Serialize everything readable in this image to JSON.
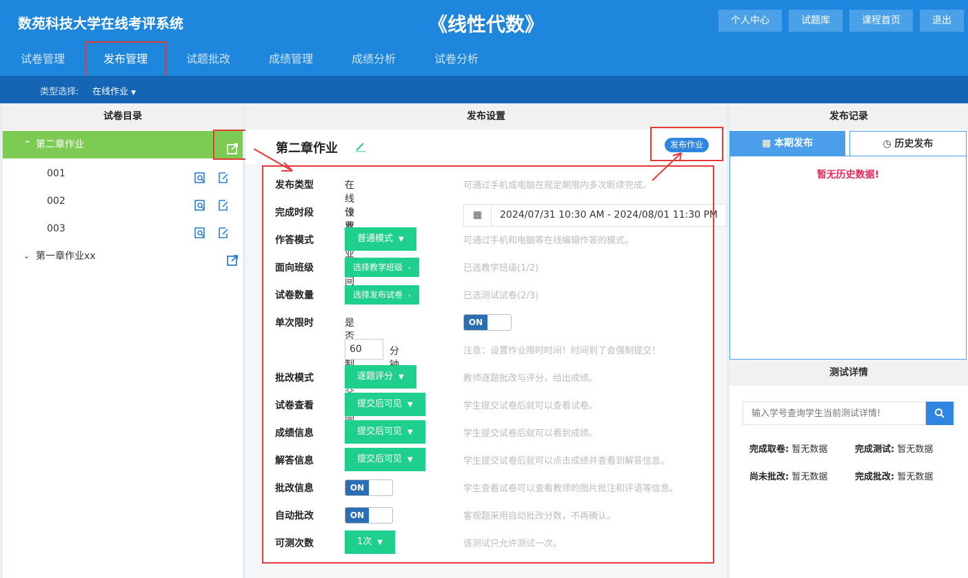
{
  "header": {
    "system_title": "数苑科技大学在线考评系统",
    "course_title": "《线性代数》",
    "buttons": [
      "个人中心",
      "试题库",
      "课程首页",
      "退出"
    ]
  },
  "nav": {
    "items": [
      "试卷管理",
      "发布管理",
      "试题批改",
      "成绩管理",
      "成绩分析",
      "试卷分析"
    ],
    "active_index": 1
  },
  "type_selector": {
    "label": "类型选择:",
    "value": "在线作业"
  },
  "left_panel": {
    "title": "试卷目录",
    "tree": [
      {
        "label": "第二章作业",
        "expanded": true,
        "children": [
          "001",
          "002",
          "003"
        ]
      },
      {
        "label": "第一章作业xx",
        "expanded": false
      }
    ]
  },
  "center_panel": {
    "title": "发布设置",
    "paper_title": "第二章作业",
    "publish_button": "发布作业",
    "rows": {
      "type": {
        "label": "发布类型",
        "value": "在线作业",
        "hint": "可通过手机或电脑在规定期限内多次断续完成。"
      },
      "period": {
        "label": "完成时段",
        "value": "设置作业时间段",
        "date_range": "2024/07/31 10:30 AM - 2024/08/01 11:30 PM"
      },
      "mode": {
        "label": "作答模式",
        "button": "普通模式",
        "hint": "可通过手机和电脑等在线编辑作答的模式。"
      },
      "classes": {
        "label": "面向班级",
        "button": "选择教学班级",
        "hint": "已选教学班级(1/2)"
      },
      "papers": {
        "label": "试卷数量",
        "button": "选择发布试卷",
        "hint": "已选测试试卷(2/3)"
      },
      "time_limit": {
        "label": "单次限时",
        "value": "是否限制提交时间",
        "toggle": "ON"
      },
      "minutes": {
        "value": "60",
        "unit": "分钟",
        "hint": "注意：设置作业限时时间！时间到了会强制提交！"
      },
      "grading": {
        "label": "批改模式",
        "button": "逐题评分",
        "hint": "教师逐题批改与评分，给出成绩。"
      },
      "view_paper": {
        "label": "试卷查看",
        "button": "提交后可见",
        "hint": "学生提交试卷后就可以查看试卷。"
      },
      "score_info": {
        "label": "成绩信息",
        "button": "提交后可见",
        "hint": "学生提交试卷后就可以看到成绩。"
      },
      "answer_info": {
        "label": "解答信息",
        "button": "提交后可见",
        "hint": "学生提交试卷后就可以点击成绩并查看到解答信息。"
      },
      "review_info": {
        "label": "批改信息",
        "toggle": "ON",
        "hint": "学生查看试卷可以查看教师的图片批注和评语等信息。"
      },
      "auto_grade": {
        "label": "自动批改",
        "toggle": "ON",
        "hint": "客观题采用自动批改分数，不再确认。"
      },
      "attempts": {
        "label": "可测次数",
        "button": "1次",
        "hint": "该测试只允许测试一次。"
      }
    }
  },
  "right_panel": {
    "title": "发布记录",
    "tabs": [
      "本期发布",
      "历史发布"
    ],
    "active_tab": 0,
    "empty_text": "暂无历史数据!",
    "detail_title": "测试详情",
    "search_placeholder": "输入学号查询学生当前测试详情!",
    "stats": [
      {
        "label": "完成取卷:",
        "value": "暂无数据"
      },
      {
        "label": "完成测试:",
        "value": "暂无数据"
      },
      {
        "label": "尚未批改:",
        "value": "暂无数据"
      },
      {
        "label": "完成批改:",
        "value": "暂无数据"
      }
    ]
  },
  "colors": {
    "primary": "#1e86dd",
    "green": "#1fcf8e",
    "tree_active": "#7ecb53",
    "annotation": "#e53935"
  }
}
